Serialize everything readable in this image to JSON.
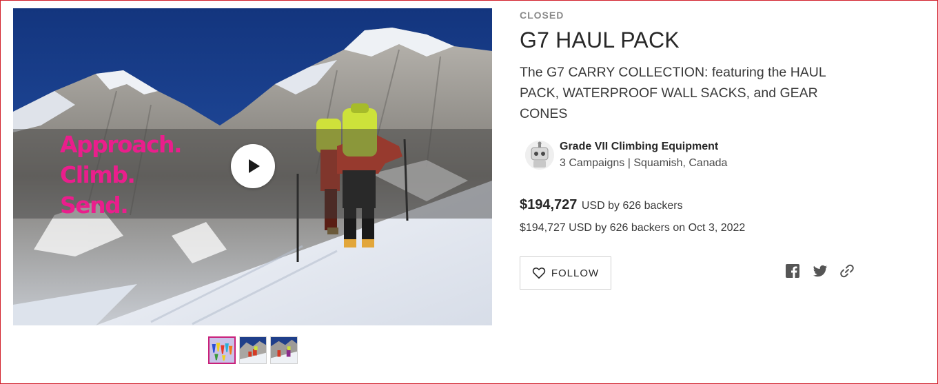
{
  "media": {
    "tagline_lines": [
      "Approach.",
      "Climb.",
      "Send."
    ],
    "play_icon": "play-icon",
    "thumbnails": [
      {
        "icon": "gear-cones-thumbnail",
        "active": true
      },
      {
        "icon": "climbers-thumbnail",
        "active": false
      },
      {
        "icon": "climbers-thumbnail",
        "active": false
      }
    ]
  },
  "campaign": {
    "status": "CLOSED",
    "title": "G7 HAUL PACK",
    "blurb": "The G7 CARRY COLLECTION: featuring the HAUL PACK, WATERPROOF WALL SACKS, and GEAR CONES"
  },
  "creator": {
    "name": "Grade VII Climbing Equipment",
    "meta": "3 Campaigns | Squamish, Canada",
    "avatar_icon": "robot-avatar-icon"
  },
  "funding": {
    "amount": "$194,727",
    "unit_text": "USD by 626 backers",
    "summary": "$194,727 USD by 626 backers on Oct 3, 2022"
  },
  "actions": {
    "follow_label": "FOLLOW",
    "follow_icon": "heart-icon",
    "share_icons": [
      "facebook-icon",
      "twitter-icon",
      "link-icon"
    ]
  },
  "colors": {
    "tagline": "#ea1e8c",
    "active_thumb_border": "#c9207a",
    "frame_border": "#d21f2a"
  }
}
